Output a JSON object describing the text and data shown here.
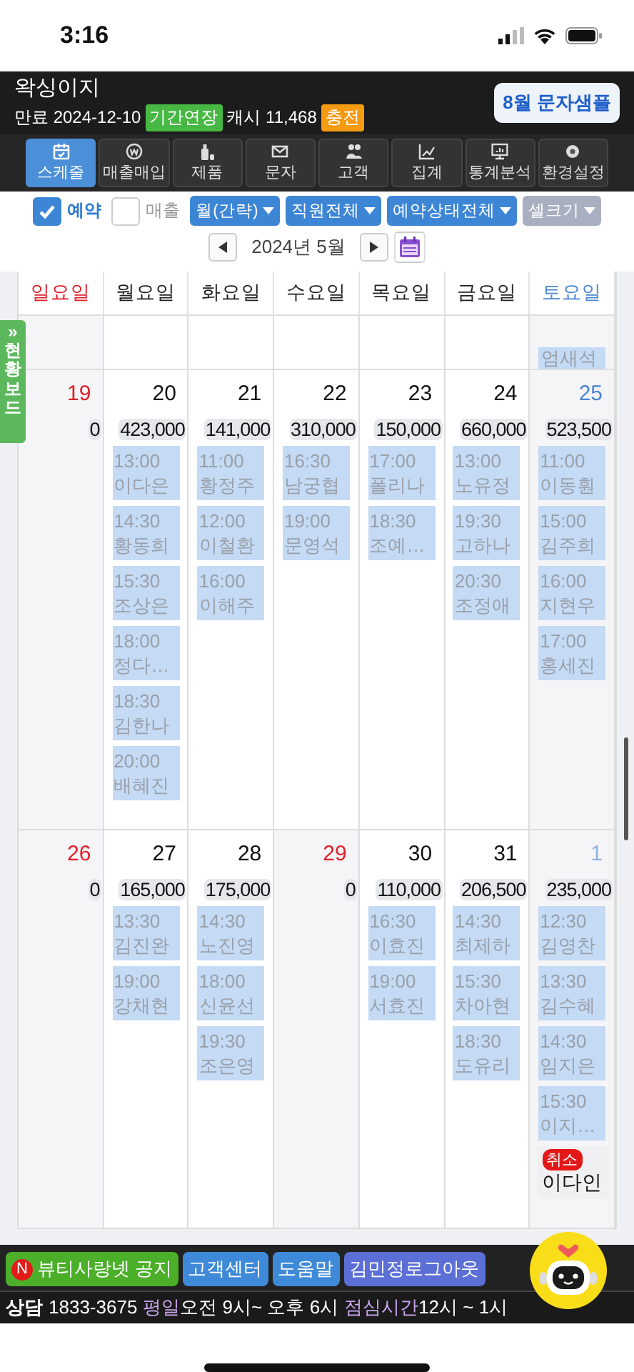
{
  "status_bar": {
    "time": "3:16"
  },
  "header": {
    "title": "왁싱이지",
    "expiry": "만료 2024-12-10",
    "extend_button": "기간연장",
    "cash": "캐시 11,468",
    "charge_button": "충전",
    "banner": "8월 문자샘플"
  },
  "nav_tabs": [
    {
      "label": "스케줄",
      "selected": true
    },
    {
      "label": "매출매입",
      "selected": false
    },
    {
      "label": "제품",
      "selected": false
    },
    {
      "label": "문자",
      "selected": false
    },
    {
      "label": "고객",
      "selected": false
    },
    {
      "label": "집계",
      "selected": false
    },
    {
      "label": "통계분석",
      "selected": false
    },
    {
      "label": "환경설정",
      "selected": false
    }
  ],
  "filters": {
    "checks": [
      {
        "label": "예약",
        "checked": true
      },
      {
        "label": "매출",
        "checked": false
      }
    ],
    "dropdowns": [
      {
        "label": "월(간략)",
        "disabled": false
      },
      {
        "label": "직원전체",
        "disabled": false
      },
      {
        "label": "예약상태전체",
        "disabled": false
      },
      {
        "label": "셀크기",
        "disabled": true
      }
    ]
  },
  "month_nav": {
    "label": "2024년 5월"
  },
  "side_tab": {
    "arrow": "»",
    "label": "현황보드"
  },
  "calendar": {
    "weekdays": [
      {
        "label": "일요일",
        "kind": "sunday"
      },
      {
        "label": "월요일",
        "kind": "weekday"
      },
      {
        "label": "화요일",
        "kind": "weekday"
      },
      {
        "label": "수요일",
        "kind": "weekday"
      },
      {
        "label": "목요일",
        "kind": "weekday"
      },
      {
        "label": "금요일",
        "kind": "weekday"
      },
      {
        "label": "토요일",
        "kind": "saturday"
      }
    ],
    "weeks": [
      {
        "days": [
          {
            "kind": "sunday"
          },
          {
            "kind": "weekday"
          },
          {
            "kind": "weekday"
          },
          {
            "kind": "weekday"
          },
          {
            "kind": "weekday"
          },
          {
            "kind": "weekday"
          },
          {
            "kind": "saturday",
            "appointments": [
              {
                "kind": "booked",
                "name": "엄새석"
              }
            ]
          }
        ]
      },
      {
        "days": [
          {
            "kind": "sunday",
            "number": "19",
            "total": "0"
          },
          {
            "kind": "weekday",
            "number": "20",
            "total": "423,000",
            "appointments": [
              {
                "kind": "booked",
                "time": "13:00",
                "name": "이다은"
              },
              {
                "kind": "booked",
                "time": "14:30",
                "name": "황동희"
              },
              {
                "kind": "booked",
                "time": "15:30",
                "name": "조상은"
              },
              {
                "kind": "booked",
                "time": "18:00",
                "name": "정다…"
              },
              {
                "kind": "booked",
                "time": "18:30",
                "name": "김한나"
              },
              {
                "kind": "booked",
                "time": "20:00",
                "name": "배혜진"
              }
            ]
          },
          {
            "kind": "weekday",
            "number": "21",
            "total": "141,000",
            "appointments": [
              {
                "kind": "booked",
                "time": "11:00",
                "name": "황정주"
              },
              {
                "kind": "booked",
                "time": "12:00",
                "name": "이철환"
              },
              {
                "kind": "booked",
                "time": "16:00",
                "name": "이해주"
              }
            ]
          },
          {
            "kind": "weekday",
            "number": "22",
            "total": "310,000",
            "appointments": [
              {
                "kind": "booked",
                "time": "16:30",
                "name": "남궁협"
              },
              {
                "kind": "booked",
                "time": "19:00",
                "name": "문영석"
              }
            ]
          },
          {
            "kind": "weekday",
            "number": "23",
            "total": "150,000",
            "appointments": [
              {
                "kind": "booked",
                "time": "17:00",
                "name": "폴리나"
              },
              {
                "kind": "booked",
                "time": "18:30",
                "name": "조예…"
              }
            ]
          },
          {
            "kind": "weekday",
            "number": "24",
            "total": "660,000",
            "appointments": [
              {
                "kind": "booked",
                "time": "13:00",
                "name": "노유정"
              },
              {
                "kind": "booked",
                "time": "19:30",
                "name": "고하나"
              },
              {
                "kind": "booked",
                "time": "20:30",
                "name": "조정애"
              }
            ]
          },
          {
            "kind": "saturday",
            "number": "25",
            "total": "523,500",
            "appointments": [
              {
                "kind": "booked",
                "time": "11:00",
                "name": "이동훤"
              },
              {
                "kind": "booked",
                "time": "15:00",
                "name": "김주희"
              },
              {
                "kind": "booked",
                "time": "16:00",
                "name": "지현우"
              },
              {
                "kind": "booked",
                "time": "17:00",
                "name": "홍세진"
              }
            ]
          }
        ]
      },
      {
        "days": [
          {
            "kind": "sunday",
            "number": "26",
            "total": "0"
          },
          {
            "kind": "weekday",
            "number": "27",
            "total": "165,000",
            "appointments": [
              {
                "kind": "booked",
                "time": "13:30",
                "name": "김진완"
              },
              {
                "kind": "booked",
                "time": "19:00",
                "name": "강채현"
              }
            ]
          },
          {
            "kind": "weekday",
            "number": "28",
            "total": "175,000",
            "appointments": [
              {
                "kind": "booked",
                "time": "14:30",
                "name": "노진영"
              },
              {
                "kind": "booked",
                "time": "18:00",
                "name": "신윤선"
              },
              {
                "kind": "booked",
                "time": "19:30",
                "name": "조은영"
              }
            ]
          },
          {
            "kind": "holiday",
            "number": "29",
            "total": "0"
          },
          {
            "kind": "weekday",
            "number": "30",
            "total": "110,000",
            "appointments": [
              {
                "kind": "booked",
                "time": "16:30",
                "name": "이효진"
              },
              {
                "kind": "booked",
                "time": "19:00",
                "name": "서효진"
              }
            ]
          },
          {
            "kind": "weekday",
            "number": "31",
            "total": "206,500",
            "appointments": [
              {
                "kind": "booked",
                "time": "14:30",
                "name": "최제하"
              },
              {
                "kind": "booked",
                "time": "15:30",
                "name": "차아현"
              },
              {
                "kind": "booked",
                "time": "18:30",
                "name": "도유리"
              }
            ]
          },
          {
            "kind": "next_month",
            "number": "1",
            "total": "235,000",
            "appointments": [
              {
                "kind": "booked",
                "time": "12:30",
                "name": "김영찬"
              },
              {
                "kind": "booked",
                "time": "13:30",
                "name": "김수혜"
              },
              {
                "kind": "booked",
                "time": "14:30",
                "name": "임지은"
              },
              {
                "kind": "booked",
                "time": "15:30",
                "name": "이지…"
              },
              {
                "kind": "canceled",
                "badge": "취소",
                "name": "이다인"
              }
            ]
          }
        ]
      }
    ]
  },
  "footer": {
    "buttons": [
      {
        "label": "뷰티사랑넷 공지",
        "badge": "N",
        "color": "#4caf2a"
      },
      {
        "label": "고객센터",
        "color": "#3f8ad8"
      },
      {
        "label": "도움말",
        "color": "#3f8ad8"
      },
      {
        "label": "김민정로그아웃",
        "color": "#5b6fd6"
      }
    ],
    "contact": [
      {
        "kind": "label",
        "text": "상담"
      },
      {
        "kind": "text",
        "text": "1833-3675"
      },
      {
        "kind": "highlight",
        "text": "평일"
      },
      {
        "kind": "text",
        "text": "오전 9시~ 오후 6시"
      },
      {
        "kind": "highlight",
        "text": "점심시간"
      },
      {
        "kind": "text",
        "text": "12시 ~ 1시"
      }
    ]
  }
}
